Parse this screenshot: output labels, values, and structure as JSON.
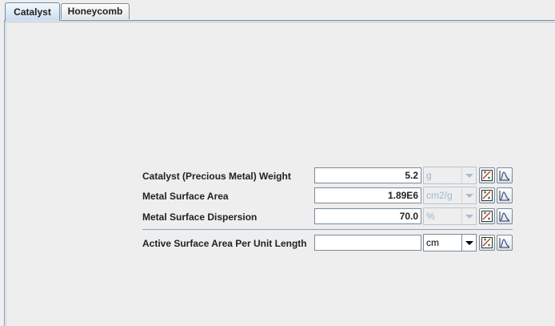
{
  "tabs": [
    {
      "label": "Catalyst",
      "selected": true
    },
    {
      "label": "Honeycomb",
      "selected": false
    }
  ],
  "rows": [
    {
      "label": "Catalyst (Precious Metal) Weight",
      "value": "5.2",
      "unit": "g",
      "unit_enabled": false
    },
    {
      "label": "Metal Surface Area",
      "value": "1.89E6",
      "unit": "cm2/g",
      "unit_enabled": false
    },
    {
      "label": "Metal Surface Dispersion",
      "value": "70.0",
      "unit": "%",
      "unit_enabled": false
    },
    {
      "label": "Active Surface Area Per Unit Length",
      "value": "",
      "unit": "cm",
      "unit_enabled": true
    }
  ],
  "icons": {
    "edit": "graph-edit-icon",
    "distribution": "distribution-curve-icon"
  },
  "colors": {
    "selected_tab": "#c9dcee",
    "disabled_unit_text": "#9db6cf",
    "background": "#eeeeee"
  }
}
